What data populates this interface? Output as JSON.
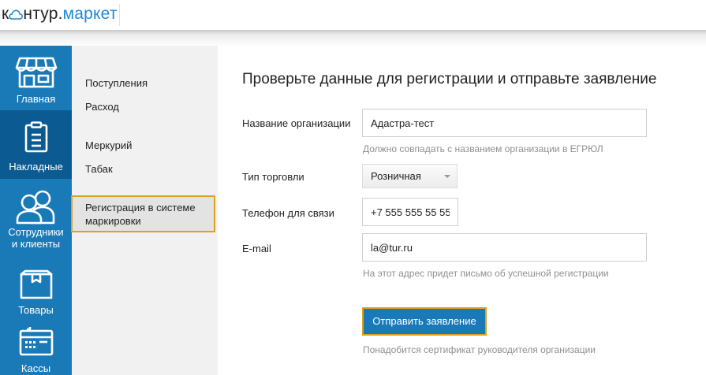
{
  "header": {
    "logo_part1": "к",
    "logo_part2": "нтур.",
    "logo_part3": "маркет"
  },
  "sidebar": {
    "items": [
      {
        "label": "Главная",
        "icon": "storefront-icon"
      },
      {
        "label": "Накладные",
        "icon": "clipboard-icon"
      },
      {
        "label_line1": "Сотрудники",
        "label_line2": "и клиенты",
        "icon": "people-icon"
      },
      {
        "label": "Товары",
        "icon": "box-icon"
      },
      {
        "label": "Кассы",
        "icon": "cash-register-icon"
      }
    ]
  },
  "submenu": {
    "items": [
      "Поступления",
      "Расход",
      "Меркурий",
      "Табак"
    ],
    "active_line1": "Регистрация в системе",
    "active_line2": "маркировки"
  },
  "form": {
    "title": "Проверьте данные для регистрации и отправьте заявление",
    "org_label": "Название организации",
    "org_value": "Адастра-тест",
    "org_hint": "Должно совпадать с названием организации в ЕГРЮЛ",
    "trade_label": "Тип торговли",
    "trade_value": "Розничная",
    "phone_label": "Телефон для связи",
    "phone_value": "+7 555 555 55 55",
    "email_label": "E-mail",
    "email_value": "la@tur.ru",
    "email_hint": "На этот адрес придет письмо об успешной регистрации",
    "submit_label": "Отправить заявление",
    "submit_hint": "Понадобится сертификат руководителя организации"
  },
  "colors": {
    "sidebar": "#1a7ab8",
    "sidebar_active": "#0b5a91",
    "accent_border": "#e0a01e",
    "brand_blue": "#1c8ad8"
  }
}
